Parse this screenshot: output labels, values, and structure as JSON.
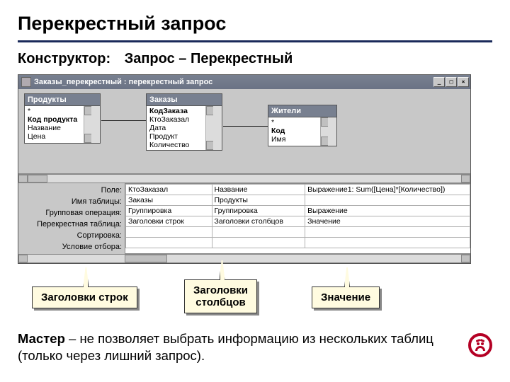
{
  "slide": {
    "title": "Перекрестный запрос",
    "subtitle_label": "Конструктор:",
    "subtitle_value": "Запрос – Перекрестный"
  },
  "window": {
    "title": "Заказы_перекрестный : перекрестный запрос",
    "btn_min": "_",
    "btn_max": "□",
    "btn_close": "×"
  },
  "tables": {
    "products": {
      "title": "Продукты",
      "rows": [
        "*",
        "Код продукта",
        "Название",
        "Цена"
      ],
      "bold_idx": 1
    },
    "orders": {
      "title": "Заказы",
      "rows": [
        "КодЗаказа",
        "КтоЗаказал",
        "Дата",
        "Продукт",
        "Количество"
      ],
      "bold_idx": 0
    },
    "residents": {
      "title": "Жители",
      "rows": [
        "*",
        "Код",
        "Имя"
      ],
      "bold_idx": 1
    }
  },
  "designer": {
    "row_labels": [
      "Поле:",
      "Имя таблицы:",
      "Групповая операция:",
      "Перекрестная таблица:",
      "Сортировка:",
      "Условие отбора:"
    ],
    "cols": [
      [
        "КтоЗаказал",
        "Заказы",
        "Группировка",
        "Заголовки строк",
        "",
        ""
      ],
      [
        "Название",
        "Продукты",
        "Группировка",
        "Заголовки столбцов",
        "",
        ""
      ],
      [
        "Выражение1: Sum([Цена]*[Количество])",
        "",
        "Выражение",
        "Значение",
        "",
        ""
      ]
    ]
  },
  "callouts": {
    "rows": "Заголовки строк",
    "cols": "Заголовки\nстолбцов",
    "val": "Значение"
  },
  "footer": {
    "bold": "Мастер",
    "rest": " – не позволяет выбрать информацию из нескольких таблиц (только через лишний запрос)."
  }
}
